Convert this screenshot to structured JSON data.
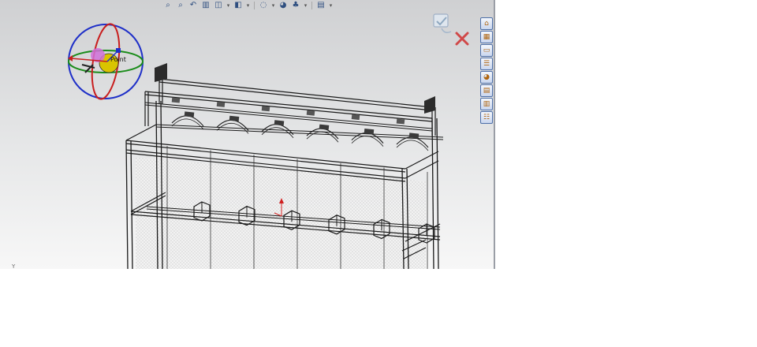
{
  "viewport": {
    "background_top": "#cfd0d2",
    "background_bottom": "#f7f7f7"
  },
  "heads_up_toolbar": {
    "buttons": [
      {
        "icon": "zoom-to-fit-icon",
        "glyph": "⌕"
      },
      {
        "icon": "zoom-to-area-icon",
        "glyph": "⌕"
      },
      {
        "icon": "previous-view-icon",
        "glyph": "↶"
      },
      {
        "icon": "section-view-icon",
        "glyph": "▥"
      },
      {
        "icon": "view-orientation-icon",
        "glyph": "◫"
      },
      {
        "icon": "display-style-icon",
        "glyph": "◧"
      },
      {
        "icon": "hide-show-items-icon",
        "glyph": "◌"
      },
      {
        "icon": "edit-appearance-icon",
        "glyph": "◕"
      },
      {
        "icon": "apply-scene-icon",
        "glyph": "♣"
      },
      {
        "icon": "view-settings-icon",
        "glyph": "▤"
      }
    ]
  },
  "move_triad": {
    "label": "Point",
    "colors": {
      "x": "#c81e1e",
      "y": "#1a8c1a",
      "z": "#1e2fc8",
      "handle": "#d9c400"
    }
  },
  "axis_indicator": {
    "label": "Y"
  },
  "confirmation_corner": {
    "ok_icon": "confirm-check-icon",
    "cancel_icon": "cancel-x-icon",
    "cancel_color": "#d04848"
  },
  "task_pane": {
    "tabs": [
      {
        "icon": "resources-icon",
        "glyph": "⌂"
      },
      {
        "icon": "design-library-icon",
        "glyph": "▦"
      },
      {
        "icon": "file-explorer-icon",
        "glyph": "▭"
      },
      {
        "icon": "view-palette-icon",
        "glyph": "☰"
      },
      {
        "icon": "appearances-icon",
        "glyph": "◕"
      },
      {
        "icon": "custom-properties-icon",
        "glyph": "▤"
      },
      {
        "icon": "toolbox-icon",
        "glyph": "▥"
      },
      {
        "icon": "forum-icon",
        "glyph": "☷"
      }
    ]
  },
  "model": {
    "line_color": "#1a1a1a",
    "rail_color": "#4a4a4a",
    "bay_count": 6
  }
}
